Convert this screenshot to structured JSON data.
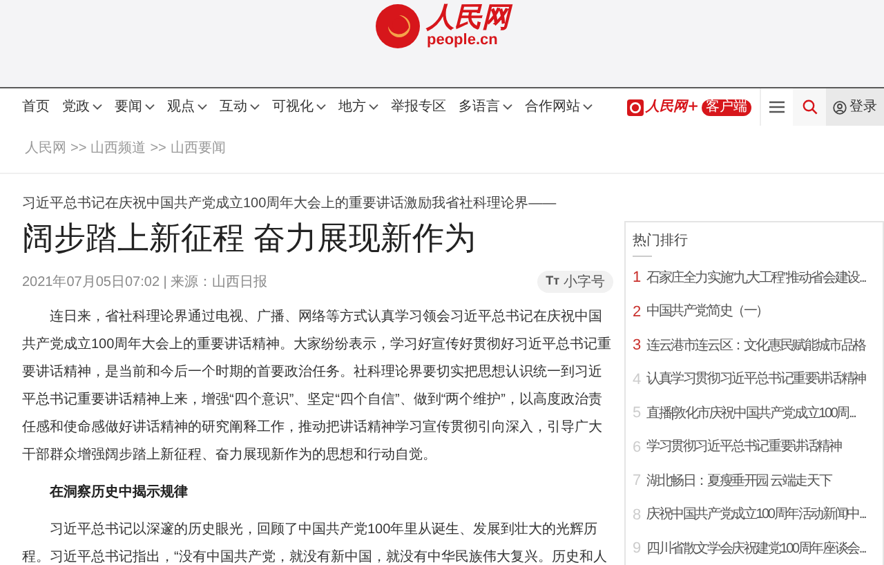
{
  "logo": {
    "name": "人民网",
    "domain": "people.cn"
  },
  "nav": {
    "items": [
      {
        "label": "首页",
        "has_menu": false
      },
      {
        "label": "党政",
        "has_menu": true
      },
      {
        "label": "要闻",
        "has_menu": true
      },
      {
        "label": "观点",
        "has_menu": true
      },
      {
        "label": "互动",
        "has_menu": true
      },
      {
        "label": "可视化",
        "has_menu": true
      },
      {
        "label": "地方",
        "has_menu": true
      },
      {
        "label": "举报专区",
        "has_menu": false
      },
      {
        "label": "多语言",
        "has_menu": true
      },
      {
        "label": "合作网站",
        "has_menu": true
      }
    ],
    "app_logo": {
      "name": "人民网+",
      "badge": "客户端"
    },
    "login": "登录"
  },
  "breadcrumb": [
    "人民网",
    "山西频道",
    "山西要闻"
  ],
  "breadcrumb_separator": ">>",
  "article": {
    "kicker": "习近平总书记在庆祝中国共产党成立100周年大会上的重要讲话激励我省社科理论界——",
    "title": "阔步踏上新征程 奋力展现新作为",
    "meta": "2021年07月05日07:02 | 来源：山西日报",
    "font_button": {
      "glyph": "Tт",
      "label": "小字号"
    },
    "blocks": [
      {
        "kind": "paragraph",
        "text": "连日来，省社科理论界通过电视、广播、网络等方式认真学习领会习近平总书记在庆祝中国共产党成立100周年大会上的重要讲话精神。大家纷纷表示，学习好宣传好贯彻好习近平总书记重要讲话精神，是当前和今后一个时期的首要政治任务。社科理论界要切实把思想认识统一到习近平总书记重要讲话精神上来，增强“四个意识”、坚定“四个自信”、做到“两个维护”，以高度政治责任感和使命感做好讲话精神的研究阐释工作，推动把讲话精神学习宣传贯彻引向深入，引导广大干部群众增强阔步踏上新征程、奋力展现新作为的思想和行动自觉。"
      },
      {
        "kind": "heading",
        "text": "在洞察历史中揭示规律"
      },
      {
        "kind": "paragraph",
        "text": "习近平总书记以深邃的历史眼光，回顾了中国共产党100年里从诞生、发展到壮大的光辉历程。习近平总书记指出，“没有中国共产党，就没有新中国，就没有中华民族伟大复兴。历史和人"
      }
    ]
  },
  "hot_list": {
    "title": "热门排行",
    "items": [
      {
        "rank": "1",
        "text": "石家庄全力实施“九大工程”推动省会建设...",
        "top": true
      },
      {
        "rank": "2",
        "text": "中国共产党简史（一）",
        "top": true
      },
      {
        "rank": "3",
        "text": "连云港市连云区：文化惠民赋能城市品格",
        "top": true
      },
      {
        "rank": "4",
        "text": "认真学习贯彻习近平总书记重要讲话精神",
        "top": false
      },
      {
        "rank": "5",
        "text": "直播|敦化市庆祝中国共产党成立100周...",
        "top": false
      },
      {
        "rank": "6",
        "text": "学习贯彻习近平总书记重要讲话精神",
        "top": false
      },
      {
        "rank": "7",
        "text": "湖北畅日：夏瘦垂开园 云端走天下",
        "top": false
      },
      {
        "rank": "8",
        "text": "庆祝中国共产党成立100周年活动新闻中...",
        "top": false
      },
      {
        "rank": "9",
        "text": "四川省散文学会庆祝建党100周年座谈会...",
        "top": false
      }
    ]
  }
}
